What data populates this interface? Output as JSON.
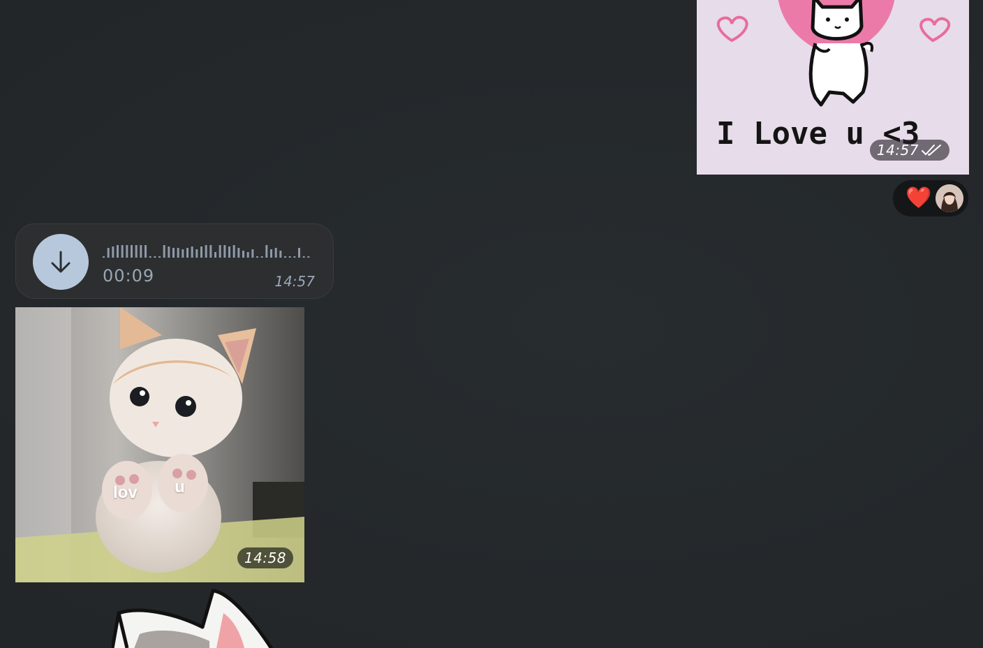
{
  "messages": {
    "outgoing_image": {
      "image_text": "I Love u <3",
      "time": "14:57",
      "status_icon": "double-check-icon"
    },
    "reaction": {
      "emoji": "❤️",
      "icon": "heart-icon",
      "avatar": "user-avatar"
    },
    "voice_message": {
      "icon": "download-arrow-icon",
      "duration": "00:09",
      "time": "14:57"
    },
    "kitten_image": {
      "caption_left": "lov",
      "caption_right": "u",
      "time": "14:58"
    },
    "bottom_sticker": {
      "icon": "cat-sticker"
    }
  },
  "colors": {
    "background": "#24282b",
    "bubble": "#2c2e30",
    "download_button": "#b8c8dc",
    "meta_text": "#9aa7b5",
    "heart": "#e8262a"
  }
}
